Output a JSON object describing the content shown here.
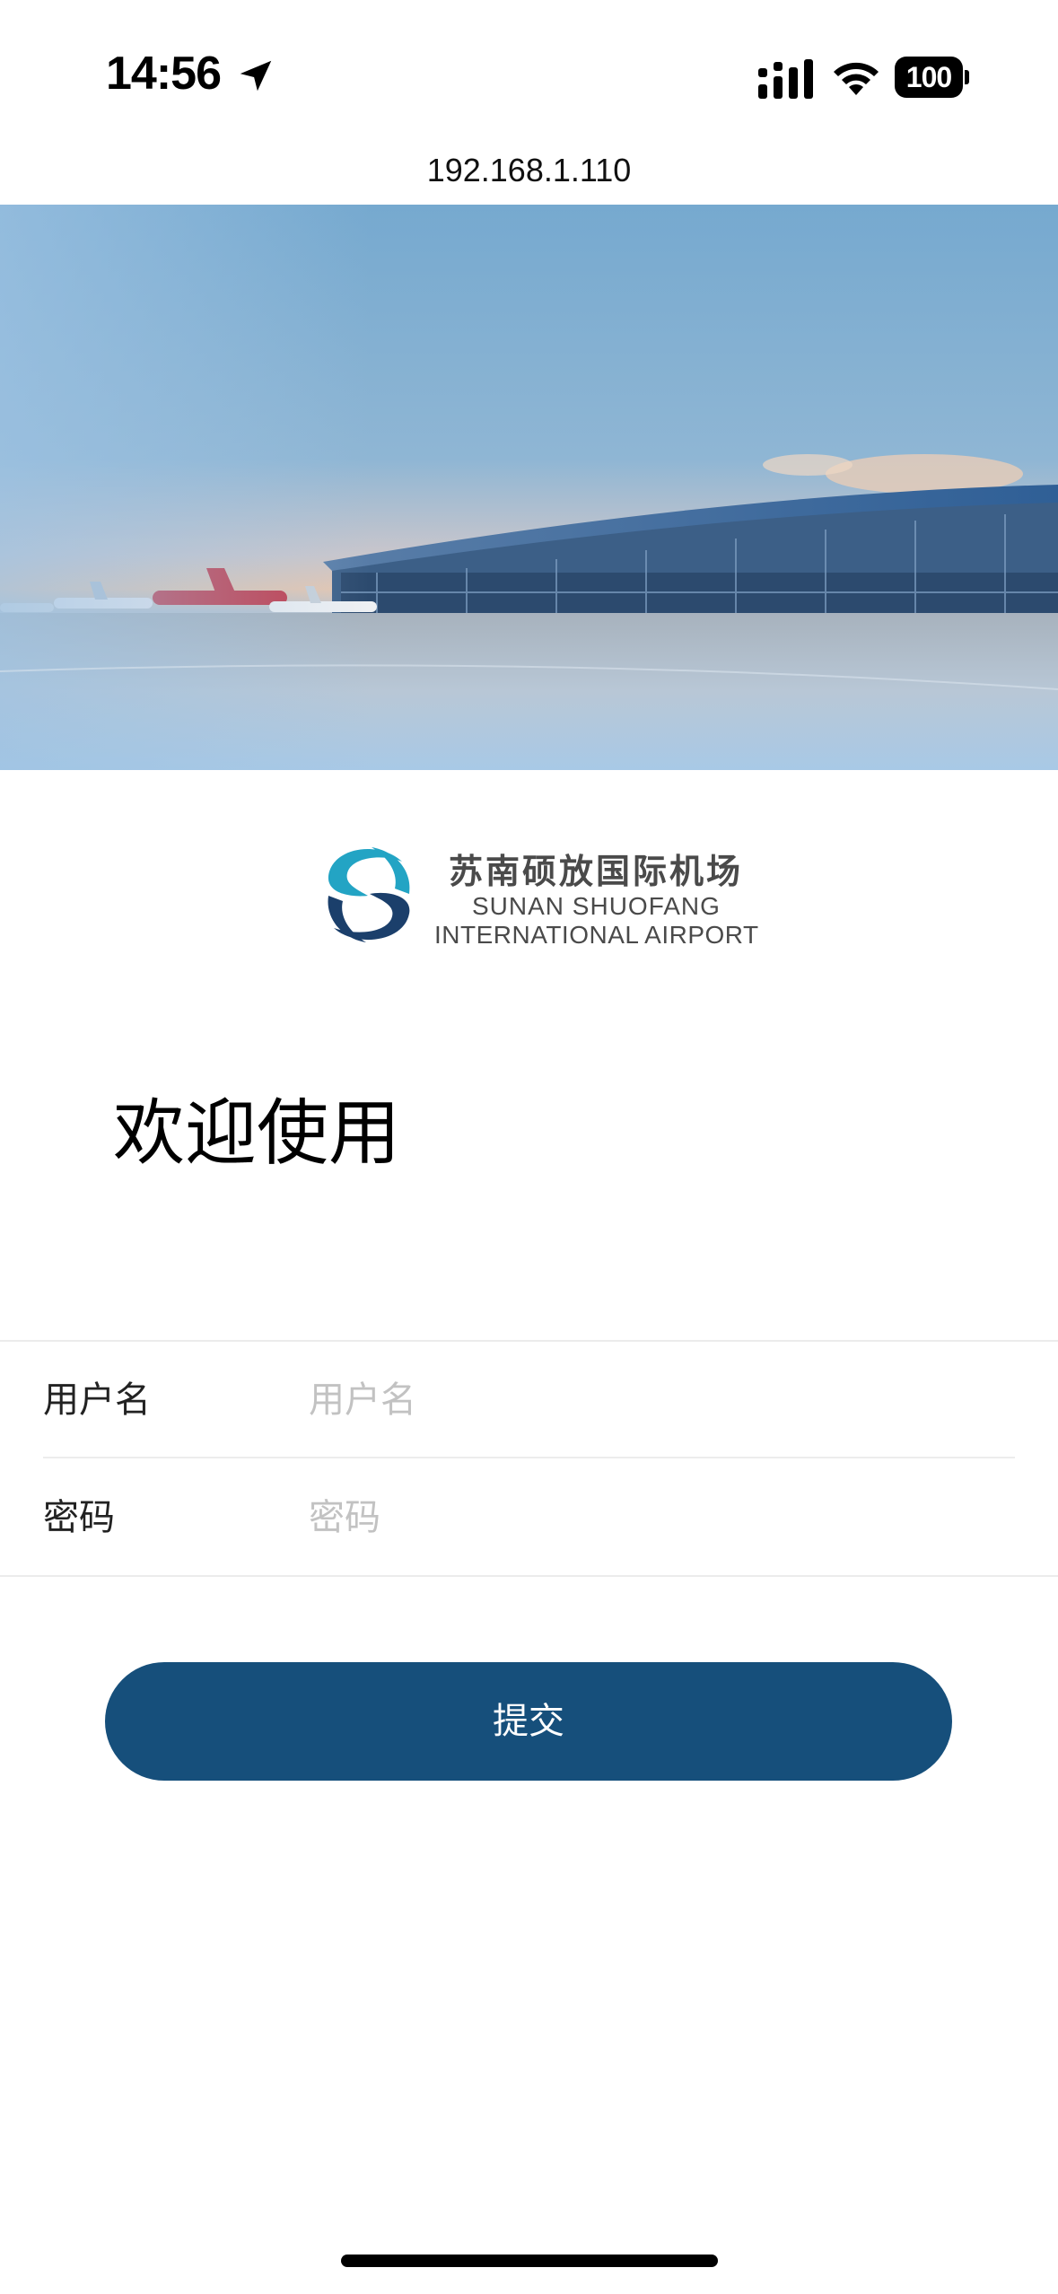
{
  "status_bar": {
    "time": "14:56",
    "battery": "100",
    "icons": [
      "location-arrow-icon",
      "cellular-signal-icon",
      "wifi-icon",
      "battery-icon"
    ]
  },
  "browser": {
    "url": "192.168.1.110"
  },
  "hero": {
    "image": "airport-terminal-photo"
  },
  "logo": {
    "cn": "苏南硕放国际机场",
    "en_line1": "SUNAN SHUOFANG",
    "en_line2": "INTERNATIONAL AIRPORT",
    "colors": {
      "teal": "#23a4c4",
      "navy": "#1b3f6b"
    }
  },
  "welcome": "欢迎使用",
  "form": {
    "username": {
      "label": "用户名",
      "placeholder": "用户名",
      "value": ""
    },
    "password": {
      "label": "密码",
      "placeholder": "密码",
      "value": ""
    }
  },
  "submit_label": "提交",
  "colors": {
    "primary": "#164f7b"
  }
}
